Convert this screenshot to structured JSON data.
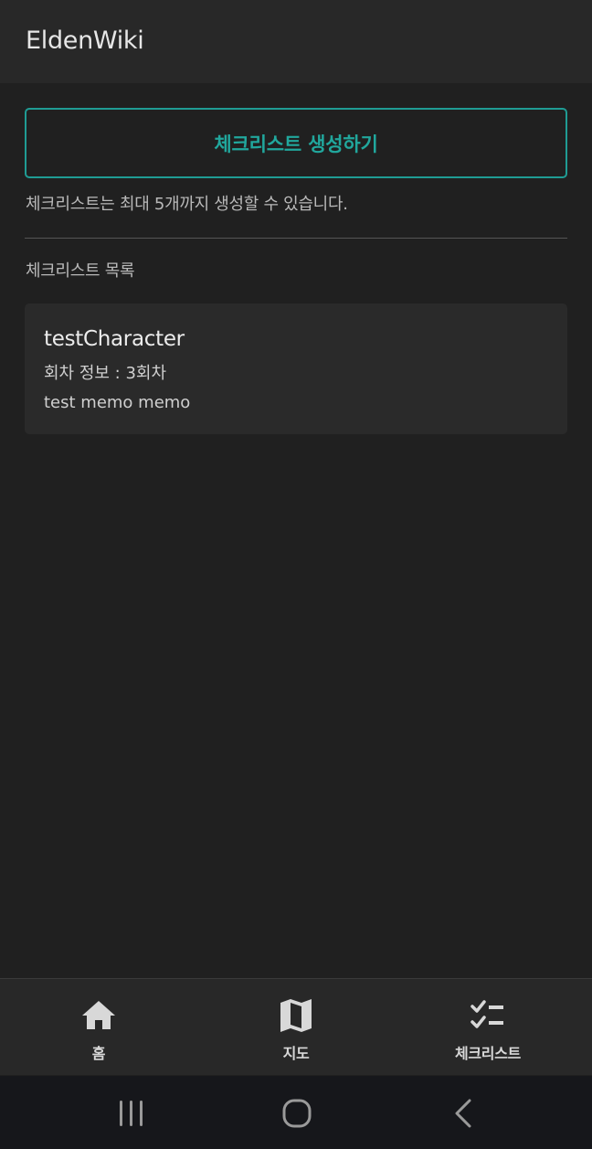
{
  "app": {
    "title": "EldenWiki"
  },
  "main": {
    "create_button_label": "체크리스트 생성하기",
    "limit_note": "체크리스트는 최대 5개까지 생성할 수 있습니다.",
    "list_title": "체크리스트 목록",
    "checklists": [
      {
        "name": "testCharacter",
        "round_info": "회차 정보 : 3회차",
        "memo": "test memo memo"
      }
    ]
  },
  "bottom_nav": {
    "items": [
      {
        "label": "홈",
        "icon": "home-icon"
      },
      {
        "label": "지도",
        "icon": "map-icon"
      },
      {
        "label": "체크리스트",
        "icon": "checklist-icon"
      }
    ]
  },
  "system_nav": {
    "buttons": [
      "recent-apps-icon",
      "home-circle-icon",
      "back-icon"
    ]
  },
  "colors": {
    "background": "#202020",
    "app_bar": "#282828",
    "accent": "#21a79d",
    "card": "#2a2a2a",
    "system_nav": "#16171b"
  }
}
